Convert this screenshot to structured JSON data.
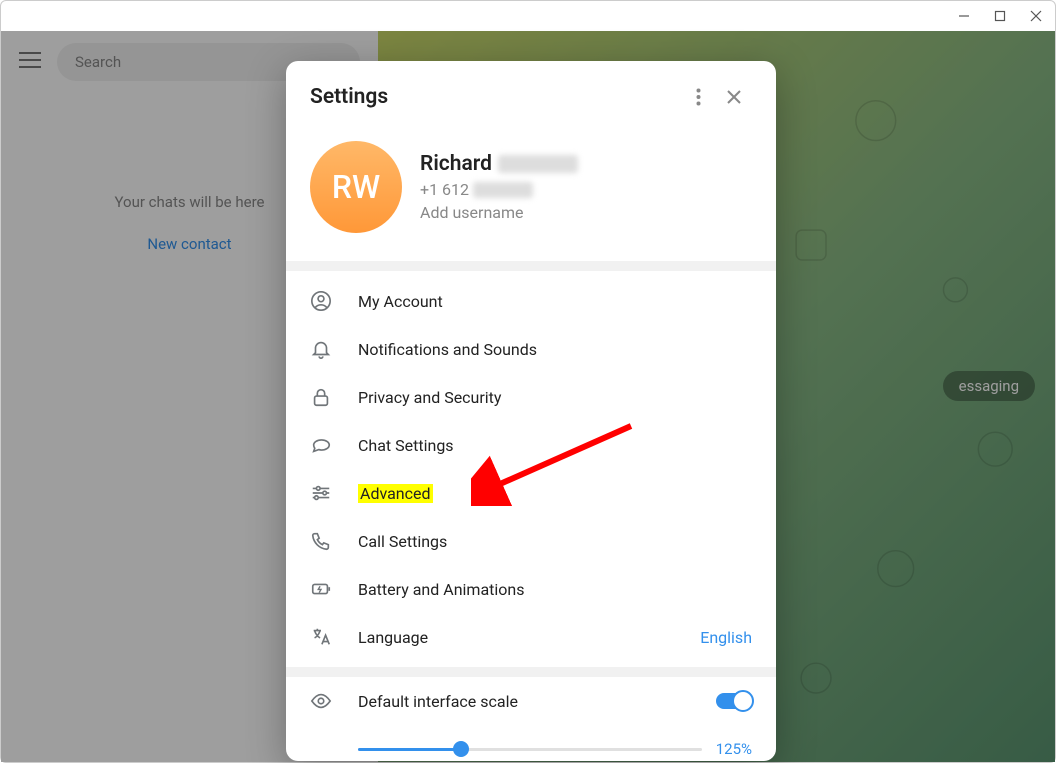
{
  "window": {
    "titlebar": {
      "minimize": "–",
      "maximize": "❐",
      "close": "✕"
    }
  },
  "sidebar": {
    "search_placeholder": "Search",
    "empty_text": "Your chats will be here",
    "new_contact": "New contact"
  },
  "chat_bg": {
    "badge": "essaging"
  },
  "settings": {
    "title": "Settings",
    "profile": {
      "initials": "RW",
      "first_name": "Richard",
      "phone_prefix": "+1 612",
      "add_username": "Add username"
    },
    "menu": [
      {
        "icon": "account",
        "label": "My Account"
      },
      {
        "icon": "bell",
        "label": "Notifications and Sounds"
      },
      {
        "icon": "lock",
        "label": "Privacy and Security"
      },
      {
        "icon": "chat",
        "label": "Chat Settings"
      },
      {
        "icon": "sliders",
        "label": "Advanced",
        "highlight": true
      },
      {
        "icon": "phone",
        "label": "Call Settings"
      },
      {
        "icon": "battery",
        "label": "Battery and Animations"
      },
      {
        "icon": "language",
        "label": "Language",
        "value": "English"
      }
    ],
    "scale": {
      "label": "Default interface scale",
      "value": "125%",
      "toggle_on": true
    }
  }
}
